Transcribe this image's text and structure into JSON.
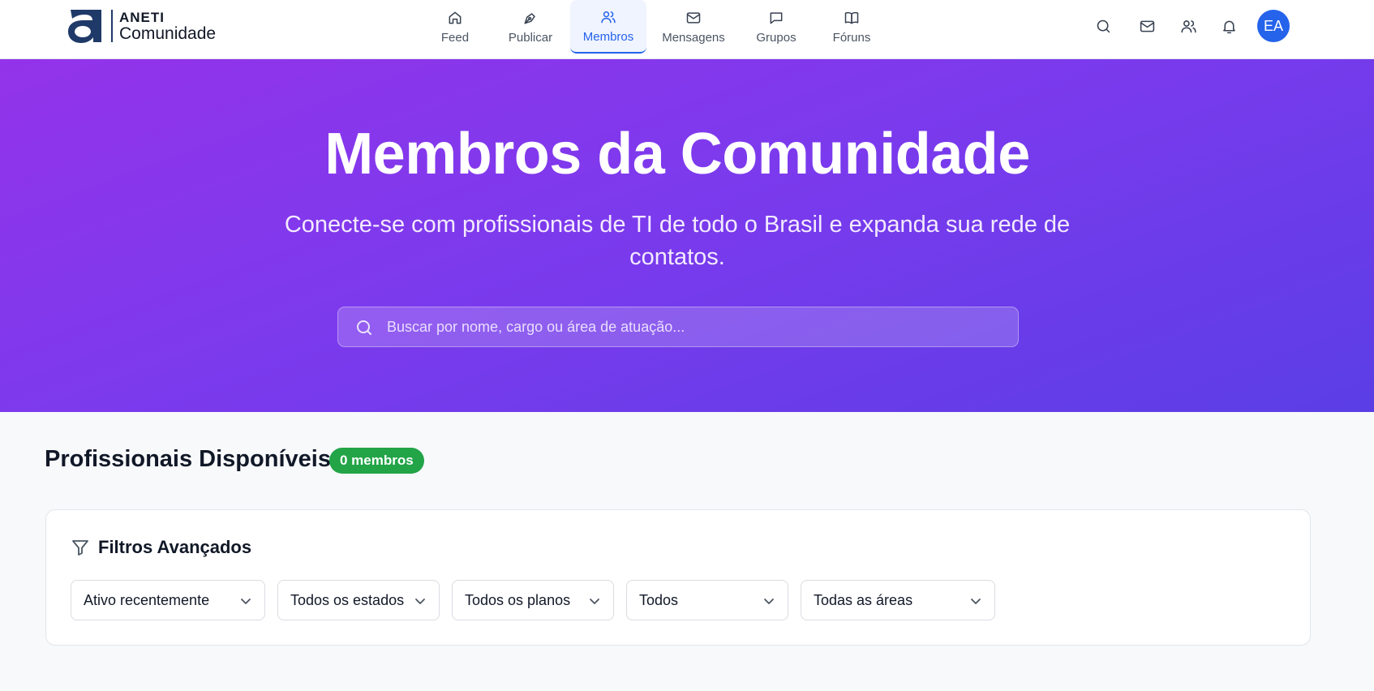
{
  "header": {
    "logo": {
      "brand": "ANETI",
      "subtitle": "Comunidade"
    },
    "nav": [
      {
        "label": "Feed",
        "icon": "home-icon",
        "active": false
      },
      {
        "label": "Publicar",
        "icon": "pen-icon",
        "active": false
      },
      {
        "label": "Membros",
        "icon": "users-icon",
        "active": true
      },
      {
        "label": "Mensagens",
        "icon": "mail-icon",
        "active": false
      },
      {
        "label": "Grupos",
        "icon": "chat-icon",
        "active": false
      },
      {
        "label": "Fóruns",
        "icon": "book-icon",
        "active": false
      }
    ],
    "actions": [
      "search-icon",
      "mail-icon",
      "users-icon",
      "bell-icon"
    ],
    "avatar_initials": "EA"
  },
  "hero": {
    "title": "Membros da Comunidade",
    "subtitle": "Conecte-se com profissionais de TI de todo o Brasil e expanda sua rede de contatos.",
    "search_placeholder": "Buscar por nome, cargo ou área de atuação..."
  },
  "section": {
    "title": "Profissionais Disponíveis",
    "count_badge": "0 membros"
  },
  "filters": {
    "title": "Filtros Avançados",
    "selects": [
      {
        "value": "Ativo recentemente"
      },
      {
        "value": "Todos os estados"
      },
      {
        "value": "Todos os planos"
      },
      {
        "value": "Todos"
      },
      {
        "value": "Todas as áreas"
      }
    ]
  },
  "colors": {
    "primary": "#2563eb",
    "hero_gradient_start": "#9333ea",
    "hero_gradient_end": "#5b3ee6",
    "badge": "#22a447"
  }
}
